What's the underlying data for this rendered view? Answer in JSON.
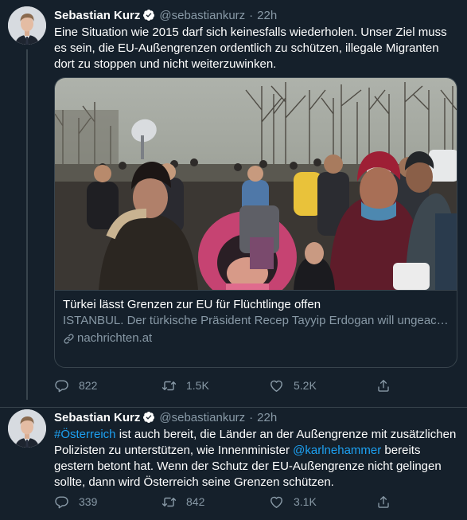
{
  "tweets": [
    {
      "author": "Sebastian Kurz",
      "handle": "@sebastiankurz",
      "separator": "·",
      "time": "22h",
      "text": "Eine Situation wie 2015 darf sich keinesfalls wiederholen. Unser Ziel muss es sein, die EU-Außengrenzen  ordentlich zu schützen, illegale Migranten dort zu stoppen und nicht weiterzuwinken.",
      "card": {
        "title": "Türkei lässt Grenzen zur EU für Flüchtlinge offen",
        "description": "ISTANBUL. Der türkische Präsident Recep Tayyip Erdogan will ungeachtet der Vereinbarungen mit der EU Flüchtlinge die Grenzen zu Griechenland...",
        "domain": "nachrichten.at"
      },
      "counts": {
        "replies": "822",
        "retweets": "1.5K",
        "likes": "5.2K"
      }
    },
    {
      "author": "Sebastian Kurz",
      "handle": "@sebastiankurz",
      "separator": "·",
      "time": "22h",
      "hashtag": "#Österreich",
      "text_part1": " ist auch bereit, die Länder an der Außengrenze mit zusätzlichen Polizisten zu unterstützen, wie Innenminister ",
      "mention": "@karlnehammer",
      "text_part2": " bereits gestern betont hat. Wenn der Schutz der EU-Außengrenze nicht gelingen sollte, dann wird Österreich seine Grenzen schützen.",
      "counts": {
        "replies": "339",
        "retweets": "842",
        "likes": "3.1K"
      }
    }
  ],
  "colors": {
    "background": "#15202b",
    "border": "#38444d",
    "secondary_text": "#8899a6",
    "accent": "#1da1f2"
  },
  "icons": [
    "verified-badge-icon",
    "reply-icon",
    "retweet-icon",
    "like-icon",
    "share-icon",
    "link-icon"
  ]
}
